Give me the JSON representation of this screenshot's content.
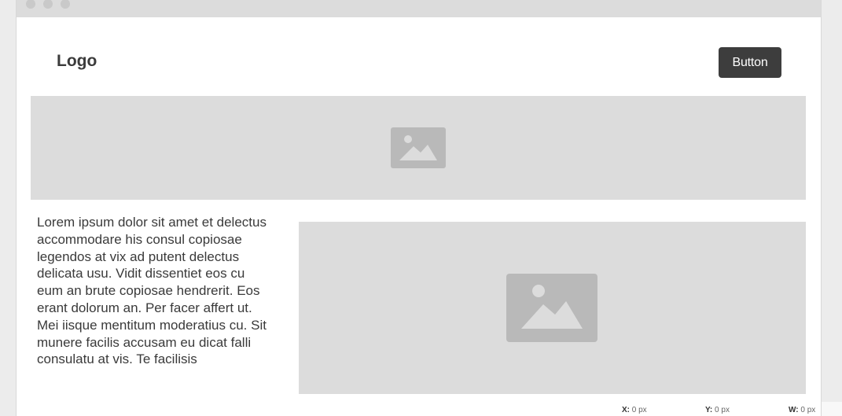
{
  "header": {
    "logo_text": "Logo",
    "button_label": "Button"
  },
  "banner": {
    "image_icon": "image-placeholder-icon"
  },
  "content": {
    "paragraph": "Lorem ipsum dolor sit amet et delectus accommodare his consul copiosae legendos at vix ad putent delectus delicata usu. Vidit dissentiet eos cu eum an brute copiosae hendrerit. Eos erant dolorum an. Per facer affert ut. Mei iisque mentitum moderatius cu. Sit munere facilis accusam eu dicat falli consulatu at vis. Te facilisis",
    "image_icon": "image-placeholder-icon"
  },
  "status": {
    "x_label": "X:",
    "x_value": "0 px",
    "y_label": "Y:",
    "y_value": "0 px",
    "w_label": "W:",
    "w_value": "0 px"
  },
  "colors": {
    "placeholder": "#dcdcdc",
    "icon": "#b9b9b9",
    "button": "#3d3d3d",
    "text": "#3a3a3a"
  }
}
